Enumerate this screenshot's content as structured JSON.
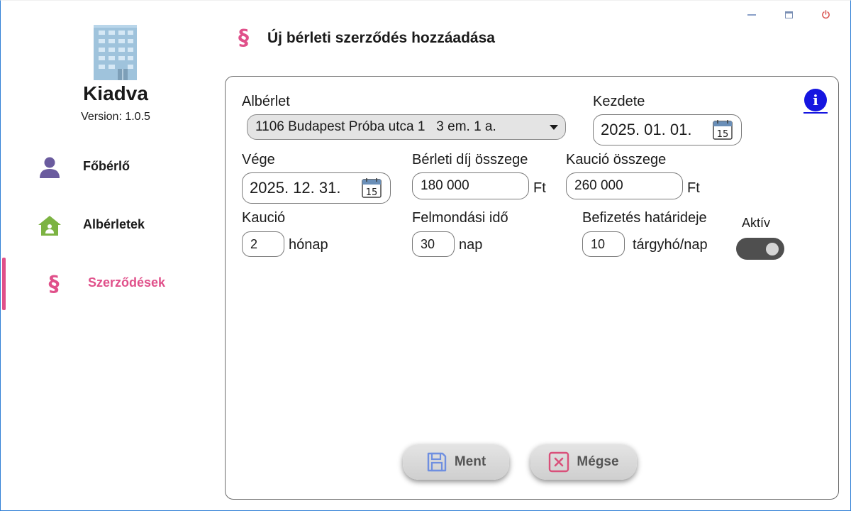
{
  "window": {
    "minimize_label": "minimize",
    "maximize_label": "maximize",
    "close_label": "power"
  },
  "app": {
    "name": "Kiadva",
    "version": "Version: 1.0.5"
  },
  "sidebar": {
    "items": [
      {
        "label": "Főbérlő",
        "icon": "person-icon",
        "active": false
      },
      {
        "label": "Albérletek",
        "icon": "house-icon",
        "active": false
      },
      {
        "label": "Szerződések",
        "icon": "paragraph-icon",
        "active": true
      }
    ]
  },
  "header": {
    "icon": "§",
    "title": "Új bérleti szerződés hozzáadása"
  },
  "form": {
    "alberlet": {
      "label": "Albérlet",
      "value": "1106 Budapest Próba utca 1   3 em. 1 a."
    },
    "kezdete": {
      "label": "Kezdete",
      "value": "2025. 01. 01.",
      "cal_day": "15"
    },
    "vege": {
      "label": "Vége",
      "value": "2025. 12. 31.",
      "cal_day": "15"
    },
    "berleti_dij": {
      "label": "Bérleti díj összege",
      "value": "180 000",
      "unit": "Ft"
    },
    "kaucio_osszege": {
      "label": "Kaució összege",
      "value": "260 000",
      "unit": "Ft"
    },
    "kaucio": {
      "label": "Kaució",
      "value": "2",
      "unit": "hónap"
    },
    "felmondasi_ido": {
      "label": "Felmondási idő",
      "value": "30",
      "unit": "nap"
    },
    "befizetes": {
      "label": "Befizetés határideje",
      "value": "10",
      "unit": "tárgyhó/nap"
    },
    "aktiv": {
      "label": "Aktív",
      "checked": true
    },
    "info_icon": "i"
  },
  "buttons": {
    "save": "Ment",
    "cancel": "Mégse"
  },
  "colors": {
    "accent": "#e0508a",
    "info": "#1515e0",
    "toggle_bg": "#4f4f4f",
    "save_icon": "#6f8fe0",
    "cancel_icon": "#d9507a"
  }
}
